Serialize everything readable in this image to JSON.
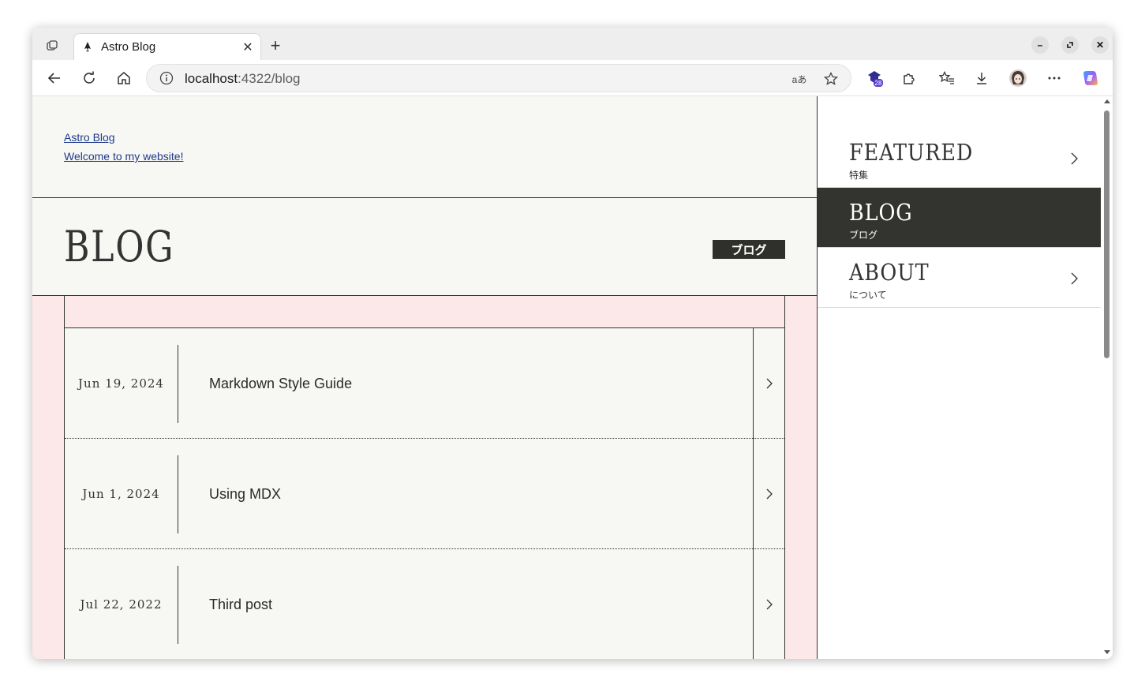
{
  "browser": {
    "tab_title": "Astro Blog",
    "url_host": "localhost",
    "url_port_path": ":4322/blog",
    "read_aloud_label": "aあ",
    "extension_badge_count": "28",
    "colors": {
      "frame": "#eeeeee",
      "toolbar": "#ffffff"
    }
  },
  "site": {
    "title_link": "Astro Blog",
    "tagline_link": "Welcome to my website!"
  },
  "hero": {
    "heading": "BLOG",
    "tag": "ブログ"
  },
  "posts": [
    {
      "date": "Jun 19, 2024",
      "title": "Markdown Style Guide"
    },
    {
      "date": "Jun 1, 2024",
      "title": "Using MDX"
    },
    {
      "date": "Jul 22, 2022",
      "title": "Third post"
    }
  ],
  "nav": [
    {
      "en": "FEATURED",
      "jp": "特集",
      "active": false
    },
    {
      "en": "BLOG",
      "jp": "ブログ",
      "active": true
    },
    {
      "en": "ABOUT",
      "jp": "について",
      "active": false
    }
  ],
  "colors": {
    "page_bg": "#f7f7f4",
    "list_bg": "#fce8e8",
    "dark": "#333330",
    "link": "#1f3a8a"
  }
}
